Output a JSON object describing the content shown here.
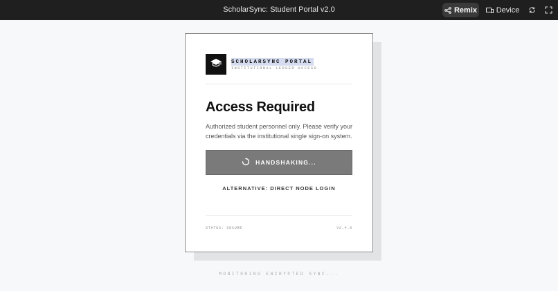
{
  "window": {
    "title": "ScholarSync: Student Portal v2.0",
    "remix_label": "Remix",
    "device_label": "Device"
  },
  "card": {
    "brand_name": "SCHOLARSYNC PORTAL",
    "brand_subtitle": "INSTITUTIONAL LEDGER ACCESS",
    "heading": "Access Required",
    "description": "Authorized student personnel only. Please verify your credentials via the institutional single sign-on system.",
    "primary_button_label": "HANDSHAKING...",
    "alternative_link": "ALTERNATIVE: DIRECT NODE LOGIN",
    "status": "STATUS: SECURE",
    "version": "V2.4.0"
  },
  "footer": {
    "text": "MONITORING ENCRYPTED SYNC..."
  },
  "icons": {
    "logo": "graduation-cap-icon",
    "remix": "remix-icon",
    "device": "device-icon",
    "refresh": "refresh-icon",
    "fullscreen": "fullscreen-icon",
    "spinner": "spinner-icon"
  },
  "colors": {
    "topbar": "#1f1f1f",
    "background": "#f7f8fa",
    "button": "#7a7a7a",
    "brand_highlight": "#d6dcf0"
  }
}
